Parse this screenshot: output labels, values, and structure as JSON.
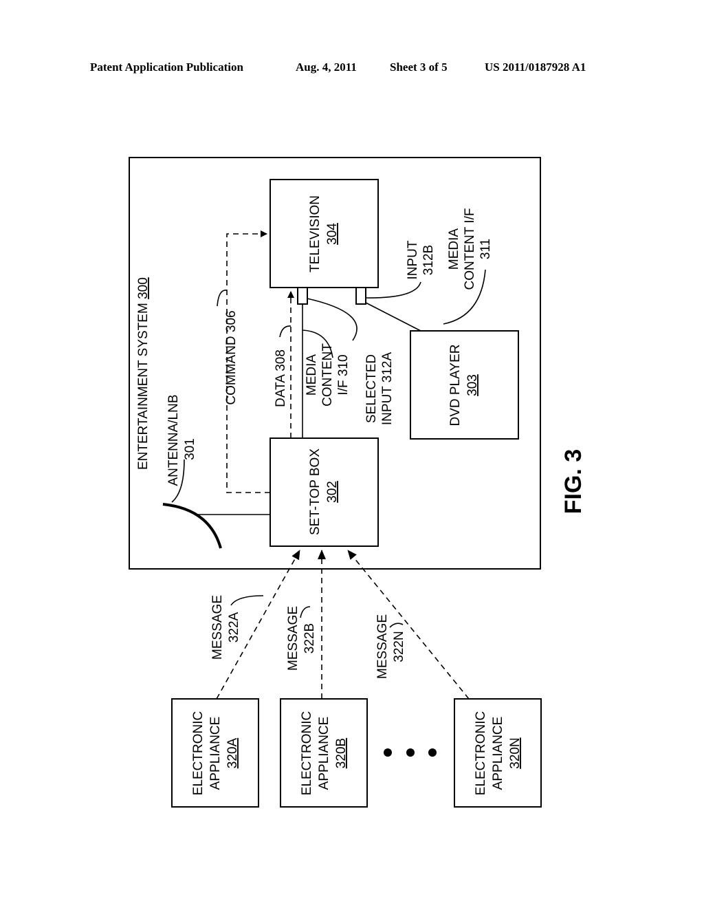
{
  "header": {
    "publication": "Patent Application Publication",
    "date": "Aug. 4, 2011",
    "sheet": "Sheet 3 of 5",
    "number": "US 2011/0187928 A1"
  },
  "figure": {
    "label": "FIG. 3",
    "system": {
      "title": "ENTERTAINMENT SYSTEM",
      "ref": "300"
    },
    "antenna": {
      "line1": "ANTENNA/LNB",
      "line2": "301"
    },
    "set_top_box": {
      "name": "SET-TOP BOX",
      "ref": "302"
    },
    "dvd_player": {
      "name": "DVD PLAYER",
      "ref": "303"
    },
    "television": {
      "name": "TELEVISION",
      "ref": "304"
    },
    "command": "COMMAND 306",
    "data": "DATA 308",
    "media_content_310": {
      "line1": "MEDIA",
      "line2": "CONTENT",
      "line3": "I/F 310"
    },
    "selected_input": {
      "line1": "SELECTED",
      "line2": "INPUT 312A"
    },
    "input_312b": {
      "line1": "INPUT",
      "line2": "312B"
    },
    "media_content_311": {
      "line1": "MEDIA",
      "line2": "CONTENT I/F",
      "line3": "311"
    },
    "appliances": [
      {
        "line1": "ELECTRONIC",
        "line2": "APPLIANCE",
        "ref": "320A"
      },
      {
        "line1": "ELECTRONIC",
        "line2": "APPLIANCE",
        "ref": "320B"
      },
      {
        "line1": "ELECTRONIC",
        "line2": "APPLIANCE",
        "ref": "320N"
      }
    ],
    "messages": [
      {
        "line1": "MESSAGE",
        "line2": "322A"
      },
      {
        "line1": "MESSAGE",
        "line2": "322B"
      },
      {
        "line1": "MESSAGE",
        "line2": "322N"
      }
    ],
    "ellipsis": "• • •"
  }
}
